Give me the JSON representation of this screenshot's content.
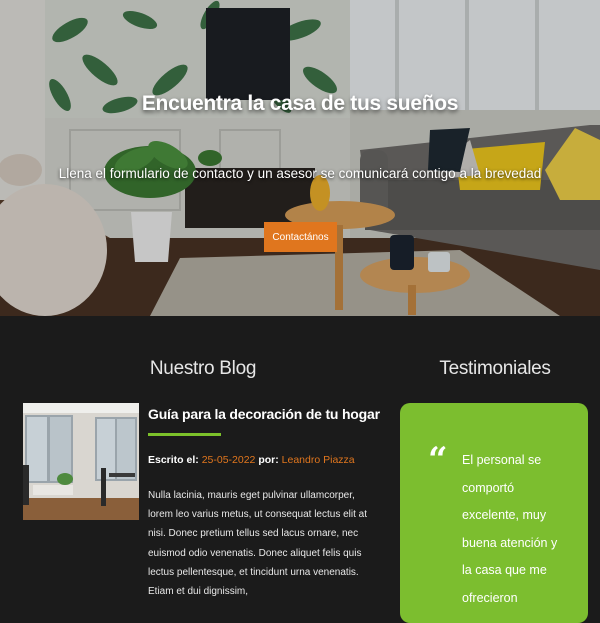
{
  "hero": {
    "title": "Encuentra la casa de tus sueños",
    "subtitle": "Llena el formulario de contacto y un asesor se comunicará contigo a la brevedad",
    "cta_label": "Contactános"
  },
  "blog": {
    "heading": "Nuestro Blog",
    "post": {
      "title": "Guía para la decoración de tu hogar",
      "meta_written_label": "Escrito el: ",
      "date": "25-05-2022",
      "meta_by_label": " por: ",
      "author": "Leandro Piazza",
      "excerpt": "Nulla lacinia, mauris eget pulvinar ullamcorper, lorem leo varius metus, ut consequat lectus elit at nisi. Donec pretium tellus sed lacus ornare, nec euismod odio venenatis. Donec aliquet felis quis lectus pellentesque, et tincidunt urna venenatis. Etiam et dui dignissim,"
    }
  },
  "testimonials": {
    "heading": "Testimoniales",
    "quote_glyph": "“",
    "text": "El personal se comportó excelente, muy buena atención y la casa que me ofrecieron"
  },
  "colors": {
    "accent_orange": "#e0761e",
    "accent_green": "#7cbe2f",
    "dark_bg": "#1b1b1b"
  }
}
